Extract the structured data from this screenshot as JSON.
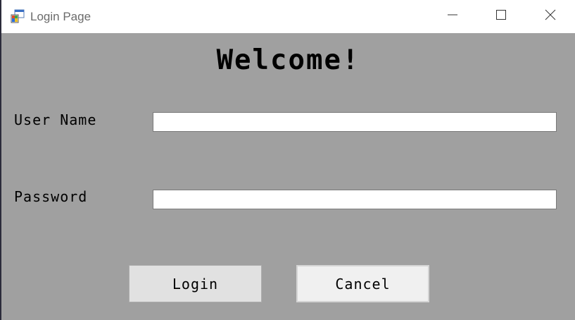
{
  "window": {
    "title": "Login Page",
    "icon": "windows-form-icon",
    "controls": {
      "minimize_icon": "minimize-icon",
      "maximize_icon": "maximize-icon",
      "close_icon": "close-icon"
    }
  },
  "form": {
    "heading": "Welcome!",
    "username": {
      "label": "User Name",
      "value": ""
    },
    "password": {
      "label": "Password",
      "value": ""
    },
    "buttons": {
      "login_label": "Login",
      "cancel_label": "Cancel"
    }
  },
  "colors": {
    "form_background": "#a0a0a0",
    "titlebar_background": "#ffffff",
    "input_background": "#ffffff"
  }
}
